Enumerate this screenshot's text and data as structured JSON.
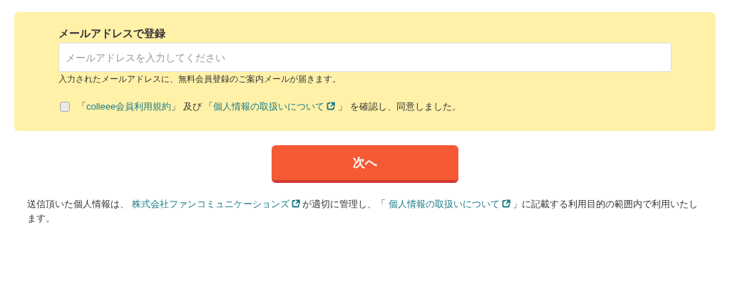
{
  "form": {
    "heading": "メールアドレスで登録",
    "email_field": {
      "placeholder": "メールアドレスを入力してください"
    },
    "hint": "入力されたメールアドレスに、無料会員登録のご案内メールが届きます。",
    "agreement": {
      "checked": false,
      "parts": [
        {
          "kind": "text",
          "text": "「"
        },
        {
          "kind": "link",
          "text": "colleee会員利用規約",
          "external": false
        },
        {
          "kind": "text",
          "text": "」 及び 「"
        },
        {
          "kind": "link",
          "text": "個人情報の取扱いについて",
          "external": true
        },
        {
          "kind": "text",
          "text": " 」 を確認し、同意しました。"
        }
      ]
    }
  },
  "next_button": "次へ",
  "notice": {
    "parts": [
      {
        "kind": "text",
        "text": "送信頂いた個人情報は、 "
      },
      {
        "kind": "link",
        "text": "株式会社ファンコミュニケーションズ",
        "external": true
      },
      {
        "kind": "text",
        "text": " が適切に管理し、「 "
      },
      {
        "kind": "link",
        "text": "個人情報の取扱いについて",
        "external": true
      },
      {
        "kind": "text",
        "text": " 」に記載する利用目的の範囲内で利用いたします。"
      }
    ]
  }
}
